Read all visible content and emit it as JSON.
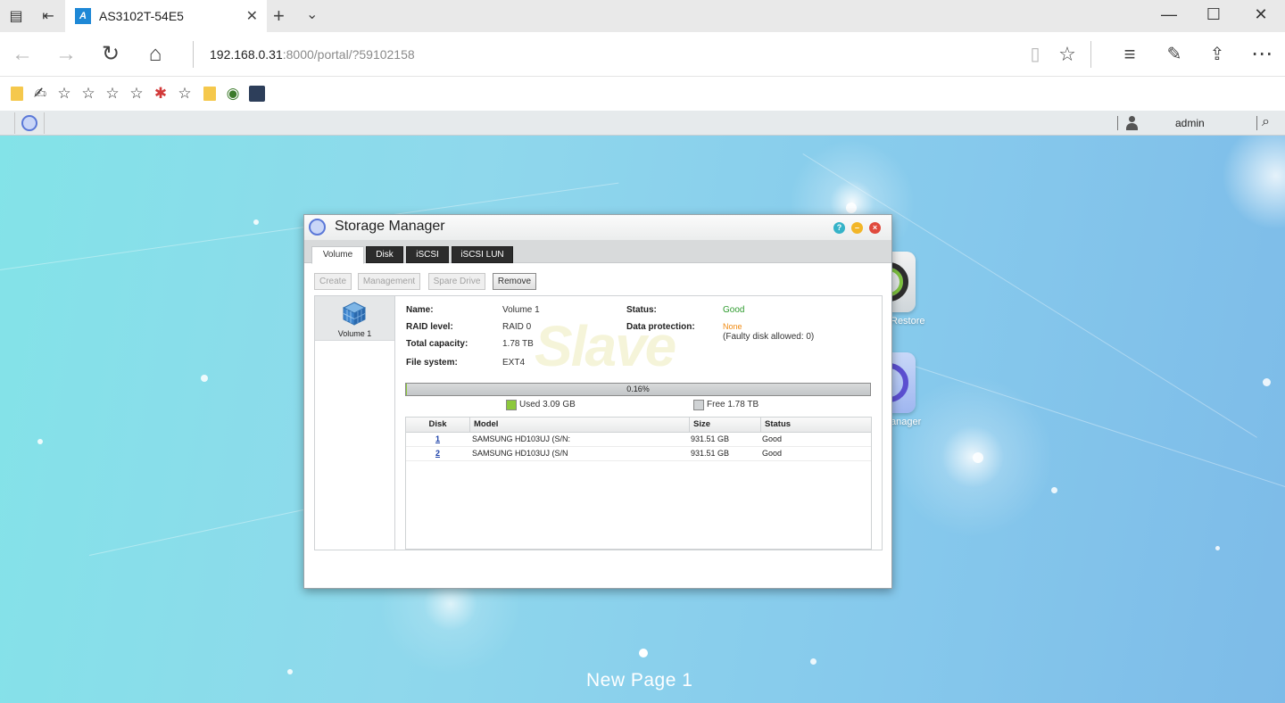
{
  "browser": {
    "tab_title": "AS3102T-54E5",
    "address_host": "192.168.0.31",
    "address_rest": ":8000/portal/?59102158",
    "icons": [
      "tab-preview-icon",
      "back-tabs-icon",
      "back-icon",
      "forward-icon",
      "refresh-icon",
      "home-icon",
      "reading-view-icon",
      "favorite-star-icon",
      "hub-icon",
      "notes-icon",
      "share-icon",
      "more-icon"
    ]
  },
  "adm_bar": {
    "username": "admin"
  },
  "window": {
    "title": "Storage Manager",
    "tabs": [
      "Volume",
      "Disk",
      "iSCSI",
      "iSCSI LUN"
    ],
    "active_tab": "Volume",
    "toolbar": {
      "create": "Create",
      "management": "Management",
      "spare_drive": "Spare Drive",
      "remove": "Remove"
    },
    "volume_list": [
      {
        "label": "Volume 1"
      }
    ],
    "details": {
      "name_label": "Name:",
      "name_value": "Volume 1",
      "raid_label": "RAID level:",
      "raid_value": "RAID 0",
      "capacity_label": "Total capacity:",
      "capacity_value": "1.78 TB",
      "fs_label": "File system:",
      "fs_value": "EXT4",
      "status_label": "Status:",
      "status_value": "Good",
      "protection_label": "Data protection:",
      "protection_value": "None",
      "faulty_note": "(Faulty disk allowed: 0)"
    },
    "usage": {
      "percent_text": "0.16%",
      "used_fraction": 0.0016,
      "used_text": "Used 3.09 GB",
      "free_text": "Free 1.78 TB",
      "used_color": "#8cc83c",
      "free_color": "#d0d3d5"
    },
    "disk_table": {
      "headers": [
        "Disk",
        "Model",
        "Size",
        "Status"
      ],
      "rows": [
        {
          "disk": "1",
          "model": "SAMSUNG HD103UJ (S/N:",
          "size": "931.51 GB",
          "status": "Good"
        },
        {
          "disk": "2",
          "model": "SAMSUNG HD103UJ (S/N",
          "size": "931.51 GB",
          "status": "Good"
        }
      ]
    }
  },
  "desktop": {
    "icon_labels": [
      "Restore",
      "anager"
    ],
    "page_label": "New Page 1"
  },
  "watermark": "Slave",
  "colors": {
    "status_good": "#2e9b2e",
    "status_none": "#f08a10",
    "close_btn": "#e04a3d",
    "min_btn": "#f2b628",
    "help_btn": "#35b3c8"
  }
}
